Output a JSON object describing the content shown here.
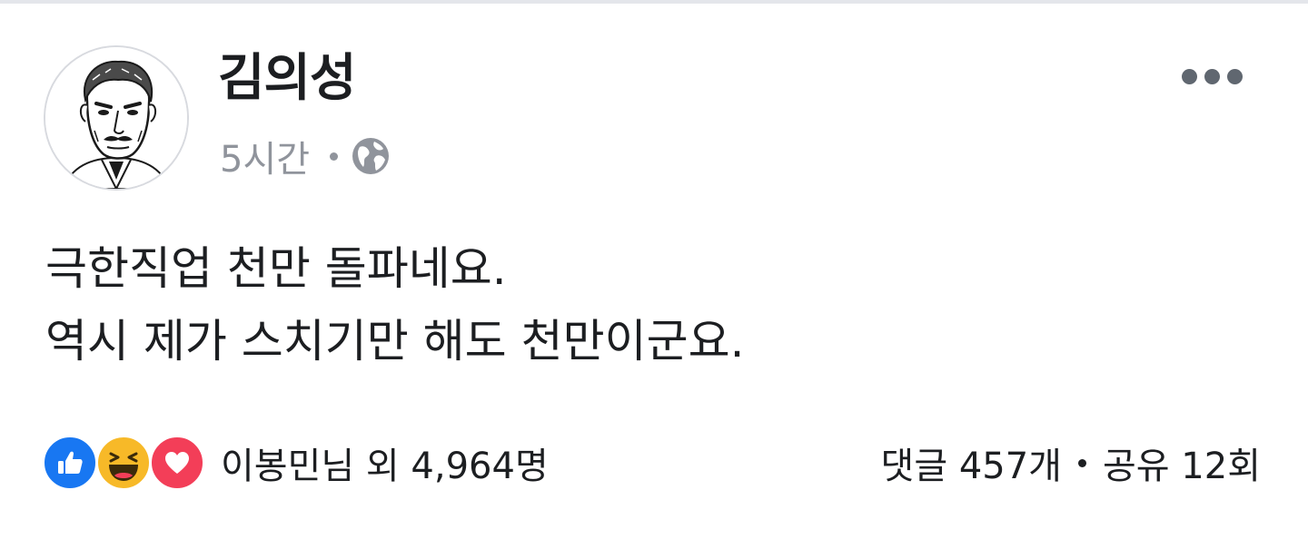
{
  "post": {
    "author": {
      "name": "김의성",
      "avatar_icon": "avatar-caricature"
    },
    "timestamp": "5시간",
    "privacy_icon": "globe-icon",
    "more_icon": "more-options-icon",
    "body_lines": [
      "극한직업 천만 돌파네요.",
      "역시 제가 스치기만 해도 천만이군요."
    ],
    "reactions": {
      "icons": [
        "like-icon",
        "haha-icon",
        "love-icon"
      ],
      "summary": "이봉민님 외 4,964명"
    },
    "comments": "댓글 457개",
    "shares": "공유 12회"
  },
  "colors": {
    "text_primary": "#1c1e21",
    "text_secondary": "#90949c",
    "like_blue": "#1877f2",
    "haha_yellow": "#f7b928",
    "love_red": "#f33e58"
  }
}
